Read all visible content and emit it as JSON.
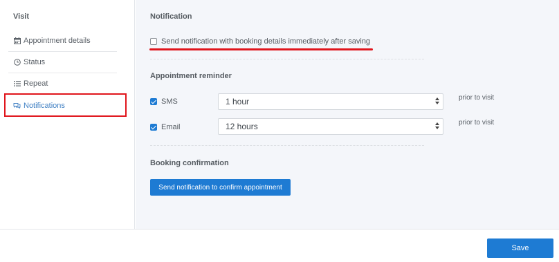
{
  "sidebar": {
    "title": "Visit",
    "items": [
      {
        "label": "Appointment details",
        "icon": "calendar-icon"
      },
      {
        "label": "Status",
        "icon": "clock-icon"
      },
      {
        "label": "Repeat",
        "icon": "list-icon"
      },
      {
        "label": "Notifications",
        "icon": "chat-icon"
      }
    ]
  },
  "notification": {
    "title": "Notification",
    "send_immediately_label": "Send notification with booking details immediately after saving",
    "send_immediately_checked": false
  },
  "reminder": {
    "title": "Appointment reminder",
    "rows": [
      {
        "channel": "SMS",
        "checked": true,
        "value": "1 hour",
        "suffix": "prior to visit"
      },
      {
        "channel": "Email",
        "checked": true,
        "value": "12 hours",
        "suffix": "prior to visit"
      }
    ]
  },
  "confirmation": {
    "title": "Booking confirmation",
    "button_label": "Send notification to confirm appointment"
  },
  "footer": {
    "save_label": "Save"
  },
  "colors": {
    "accent": "#1e7bd3",
    "highlight": "#e0151c",
    "active_nav": "#3f7fc3"
  }
}
